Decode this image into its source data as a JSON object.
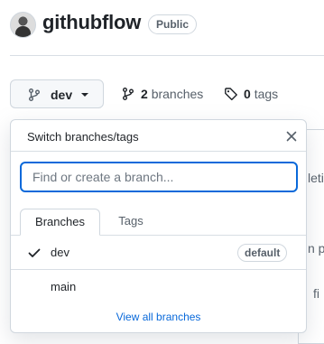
{
  "repo": {
    "name": "githubflow",
    "visibility": "Public"
  },
  "branch_button": {
    "current": "dev"
  },
  "branches_link": {
    "count": "2",
    "label": "branches"
  },
  "tags_link": {
    "count": "0",
    "label": "tags"
  },
  "background_fragments": [
    "leti",
    "n p",
    "fi"
  ],
  "dropdown": {
    "title": "Switch branches/tags",
    "search_placeholder": "Find or create a branch...",
    "tabs": [
      {
        "label": "Branches",
        "active": true
      },
      {
        "label": "Tags",
        "active": false
      }
    ],
    "items": [
      {
        "label": "dev",
        "selected": true,
        "badge": "default"
      },
      {
        "label": "main",
        "selected": false,
        "badge": ""
      }
    ],
    "view_all": "View all branches"
  },
  "colors": {
    "accent": "#0969da",
    "border": "#d0d7de",
    "text": "#1f2328",
    "muted": "#57606a"
  },
  "icons": [
    "avatar",
    "git-branch-icon",
    "chevron-down-icon",
    "tag-icon",
    "close-icon",
    "check-icon"
  ]
}
